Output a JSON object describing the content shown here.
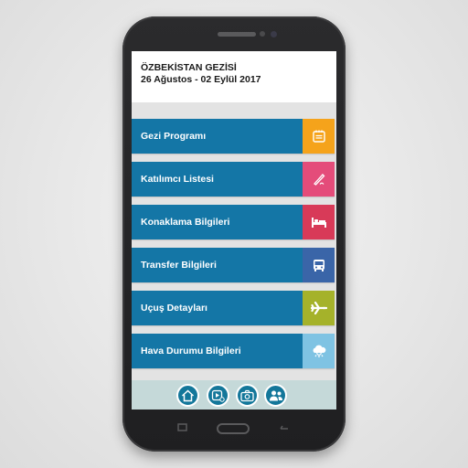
{
  "header": {
    "title": "ÖZBEKİSTAN GEZİSİ",
    "date_range": "26 Ağustos - 02 Eylül 2017"
  },
  "menu": {
    "items": [
      {
        "label": "Gezi Programı",
        "icon": "notepad-icon",
        "icon_color": "#f5a31b"
      },
      {
        "label": "Katılımcı Listesi",
        "icon": "pen-icon",
        "icon_color": "#e44c7a"
      },
      {
        "label": "Konaklama Bilgileri",
        "icon": "bed-icon",
        "icon_color": "#d83a58"
      },
      {
        "label": "Transfer Bilgileri",
        "icon": "bus-icon",
        "icon_color": "#3a65a8"
      },
      {
        "label": "Uçuş Detayları",
        "icon": "airplane-icon",
        "icon_color": "#a5b22a"
      },
      {
        "label": "Hava Durumu Bilgileri",
        "icon": "weather-icon",
        "icon_color": "#7fc3e3"
      }
    ],
    "bar_color": "#1476a6"
  },
  "bottom_nav": {
    "buttons": [
      {
        "icon": "home-icon"
      },
      {
        "icon": "play-video-icon"
      },
      {
        "icon": "camera-icon"
      },
      {
        "icon": "people-icon"
      }
    ],
    "accent": "#13779a"
  }
}
